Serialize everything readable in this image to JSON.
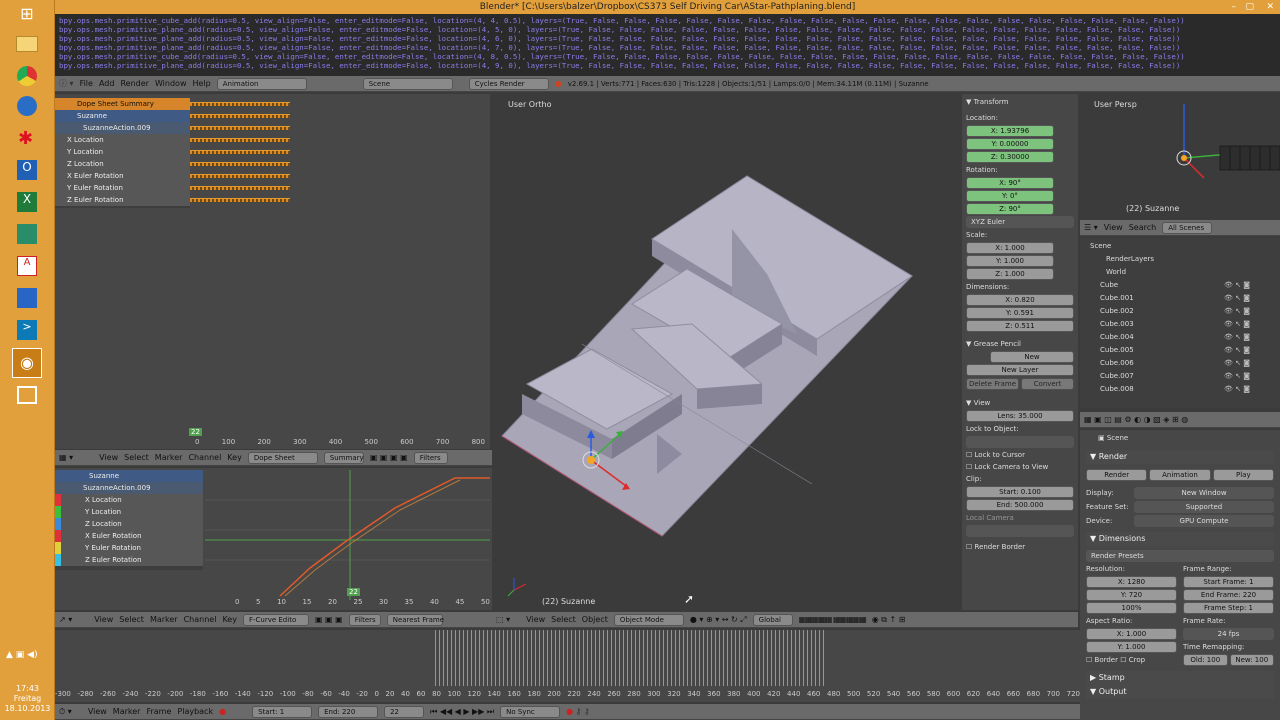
{
  "window": {
    "title": "Blender* [C:\\Users\\balzer\\Dropbox\\CS373 Self Driving Car\\AStar-Pathplaning.blend]"
  },
  "console": {
    "lines": [
      "bpy.ops.mesh.primitive_cube_add(radius=0.5, view_align=False, enter_editmode=False, location=(4, 4, 0.5), layers=(True, False, False, False, False, False, False, False, False, False, False, False, False, False, False, False, False, False, False, False))",
      "bpy.ops.mesh.primitive_plane_add(radius=0.5, view_align=False, enter_editmode=False, location=(4, 5, 0), layers=(True, False, False, False, False, False, False, False, False, False, False, False, False, False, False, False, False, False, False, False))",
      "bpy.ops.mesh.primitive_plane_add(radius=0.5, view_align=False, enter_editmode=False, location=(4, 6, 0), layers=(True, False, False, False, False, False, False, False, False, False, False, False, False, False, False, False, False, False, False, False))",
      "bpy.ops.mesh.primitive_plane_add(radius=0.5, view_align=False, enter_editmode=False, location=(4, 7, 0), layers=(True, False, False, False, False, False, False, False, False, False, False, False, False, False, False, False, False, False, False, False))",
      "bpy.ops.mesh.primitive_cube_add(radius=0.5, view_align=False, enter_editmode=False, location=(4, 8, 0.5), layers=(True, False, False, False, False, False, False, False, False, False, False, False, False, False, False, False, False, False, False, False))",
      "bpy.ops.mesh.primitive_plane_add(radius=0.5, view_align=False, enter_editmode=False, location=(4, 9, 0), layers=(True, False, False, False, False, False, False, False, False, False, False, False, False, False, False, False, False, False, False, False))"
    ]
  },
  "info_header": {
    "menus": [
      "File",
      "Add",
      "Render",
      "Window",
      "Help"
    ],
    "layout": "Animation",
    "scene": "Scene",
    "engine": "Cycles Render",
    "stats": "v2.69.1 | Verts:771 | Faces:630 | Tris:1228 | Objects:1/51 | Lamps:0/0 | Mem:34.11M (0.11M) | Suzanne"
  },
  "dopesheet": {
    "channels": [
      "Dope Sheet Summary",
      "Suzanne",
      "SuzanneAction.009",
      "X Location",
      "Y Location",
      "Z Location",
      "X Euler Rotation",
      "Y Euler Rotation",
      "Z Euler Rotation"
    ],
    "frame_marker": "22",
    "ruler": [
      "0",
      "100",
      "200",
      "300",
      "400",
      "500",
      "600",
      "700",
      "800"
    ],
    "menus": [
      "View",
      "Select",
      "Marker",
      "Channel",
      "Key"
    ],
    "mode": "Dope Sheet",
    "summary": "Summary",
    "filters": "Filters"
  },
  "graph": {
    "channels": [
      "Suzanne",
      "SuzanneAction.009",
      "X Location",
      "Y Location",
      "Z Location",
      "X Euler Rotation",
      "Y Euler Rotation",
      "Z Euler Rotation"
    ],
    "ruler": [
      "0",
      "5",
      "10",
      "15",
      "20",
      "25",
      "30",
      "35",
      "40",
      "45",
      "50"
    ],
    "frame_marker": "22",
    "menus": [
      "View",
      "Select",
      "Marker",
      "Channel",
      "Key"
    ],
    "mode": "F-Curve Edito",
    "filters": "Filters",
    "pivot": "Nearest Frame"
  },
  "viewport": {
    "label": "User Ortho",
    "object_label": "(22) Suzanne",
    "menus": [
      "View",
      "Select",
      "Object"
    ],
    "mode": "Object Mode",
    "orientation": "Global"
  },
  "properties_n": {
    "transform": "Transform",
    "location_label": "Location:",
    "location": [
      "X: 1.93796",
      "Y: 0.00000",
      "Z: 0.30000"
    ],
    "rotation_label": "Rotation:",
    "rotation": [
      "X: 90°",
      "Y: 0°",
      "Z: 90°"
    ],
    "rotation_mode": "XYZ Euler",
    "scale_label": "Scale:",
    "scale": [
      "X: 1.000",
      "Y: 1.000",
      "Z: 1.000"
    ],
    "dimensions_label": "Dimensions:",
    "dimensions": [
      "X: 0.820",
      "Y: 0.591",
      "Z: 0.511"
    ],
    "grease_pencil": "Grease Pencil",
    "new": "New",
    "new_layer": "New Layer",
    "delete_frame": "Delete Frame",
    "convert": "Convert",
    "view": "View",
    "lens": "Lens: 35.000",
    "lock_to_object": "Lock to Object:",
    "lock_to_cursor": "Lock to Cursor",
    "lock_camera_to_view": "Lock Camera to View",
    "clip": "Clip:",
    "clip_start": "Start: 0.100",
    "clip_end": "End: 500.000",
    "local_camera": "Local Camera",
    "render_border": "Render Border"
  },
  "mini_view": {
    "label": "User Persp",
    "object": "(22) Suzanne"
  },
  "outliner": {
    "menus": [
      "View",
      "Search"
    ],
    "filter": "All Scenes",
    "items": [
      "Scene",
      "RenderLayers",
      "World",
      "Cube",
      "Cube.001",
      "Cube.002",
      "Cube.003",
      "Cube.004",
      "Cube.005",
      "Cube.006",
      "Cube.007",
      "Cube.008"
    ]
  },
  "render_props": {
    "scene": "Scene",
    "render": "Render",
    "buttons": [
      "Render",
      "Animation",
      "Play"
    ],
    "display_label": "Display:",
    "display": "New Window",
    "feature_set_label": "Feature Set:",
    "feature_set": "Supported",
    "device_label": "Device:",
    "device": "GPU Compute",
    "dimensions": "Dimensions",
    "render_presets": "Render Presets",
    "resolution_label": "Resolution:",
    "res_x": "X: 1280",
    "res_y": "Y: 720",
    "res_pct": "100%",
    "frame_range_label": "Frame Range:",
    "start_frame": "Start Frame: 1",
    "end_frame": "End Frame: 220",
    "frame_step": "Frame Step: 1",
    "aspect_label": "Aspect Ratio:",
    "aspect_x": "X: 1.000",
    "aspect_y": "Y: 1.000",
    "frame_rate_label": "Frame Rate:",
    "fps": "24 fps",
    "time_remap_label": "Time Remapping:",
    "old": "Old: 100",
    "new": "New: 100",
    "border": "Border",
    "crop": "Crop",
    "stamp": "Stamp",
    "output": "Output"
  },
  "timeline": {
    "ruler": [
      "-300",
      "-280",
      "-260",
      "-240",
      "-220",
      "-200",
      "-180",
      "-160",
      "-140",
      "-120",
      "-100",
      "-80",
      "-60",
      "-40",
      "-20",
      "0",
      "20",
      "40",
      "60",
      "80",
      "100",
      "120",
      "140",
      "160",
      "180",
      "200",
      "220",
      "240",
      "260",
      "280",
      "300",
      "320",
      "340",
      "360",
      "380",
      "400",
      "420",
      "440",
      "460",
      "480",
      "500",
      "520",
      "540",
      "560",
      "580",
      "600",
      "620",
      "640",
      "660",
      "680",
      "700",
      "720"
    ],
    "menus": [
      "View",
      "Marker",
      "Frame",
      "Playback"
    ],
    "start": "Start: 1",
    "end": "End: 220",
    "current": "22",
    "sync": "No Sync"
  },
  "taskbar": {
    "time": "17:43",
    "day": "Freitag",
    "date": "18.10.2013"
  },
  "colors": {
    "accent": "#e08a1e",
    "selected": "#f5a623",
    "green_field": "#7dc27d"
  }
}
